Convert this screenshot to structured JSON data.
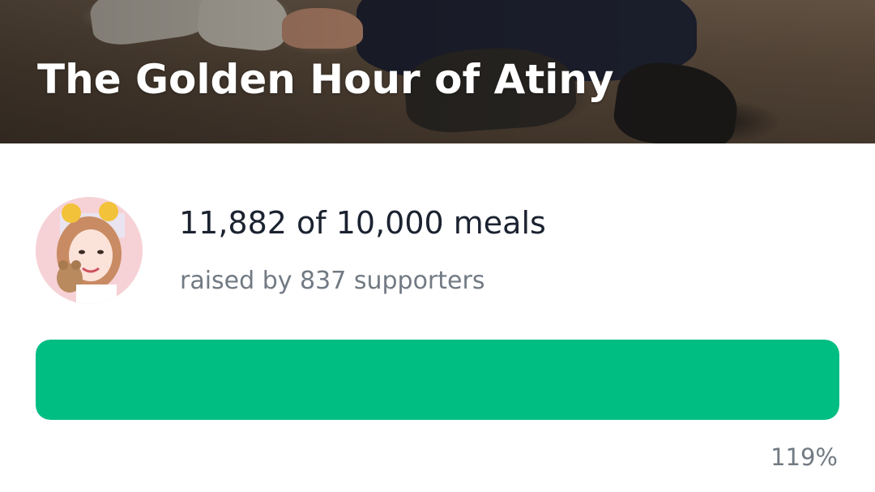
{
  "campaign": {
    "title": "The Golden Hour of Atiny"
  },
  "stats": {
    "meals_text": "11,882 of 10,000 meals",
    "supporters_text": "raised by 837 supporters",
    "percent_text": "119%",
    "progress_fraction": 1.0
  },
  "icons": {
    "avatar": "fundraiser-avatar"
  },
  "colors": {
    "accent": "#00be82",
    "title_text": "#ffffff",
    "primary_text": "#1b2230",
    "secondary_text": "#727a83"
  }
}
